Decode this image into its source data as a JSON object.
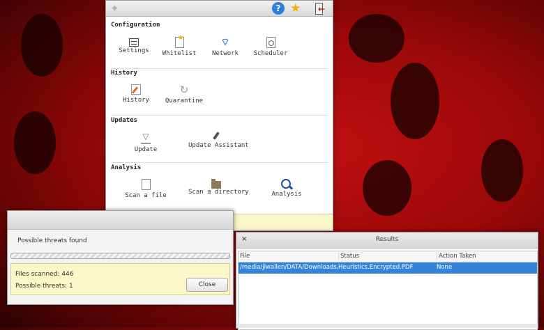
{
  "main": {
    "sections": [
      {
        "title": "Configuration",
        "items": [
          {
            "label": "Settings",
            "icon": "settings-icon"
          },
          {
            "label": "Whitelist",
            "icon": "whitelist-icon"
          },
          {
            "label": "Network",
            "icon": "network-icon"
          },
          {
            "label": "Scheduler",
            "icon": "scheduler-icon"
          }
        ]
      },
      {
        "title": "History",
        "items": [
          {
            "label": "History",
            "icon": "history-icon"
          },
          {
            "label": "Quarantine",
            "icon": "quarantine-icon"
          }
        ]
      },
      {
        "title": "Updates",
        "items": [
          {
            "label": "Update",
            "icon": "update-icon"
          },
          {
            "label": "Update Assistant",
            "icon": "update-assistant-icon"
          }
        ]
      },
      {
        "title": "Analysis",
        "items": [
          {
            "label": "Scan a file",
            "icon": "scan-file-icon"
          },
          {
            "label": "Scan a directory",
            "icon": "scan-directory-icon"
          },
          {
            "label": "Analysis",
            "icon": "analysis-icon"
          }
        ]
      }
    ],
    "toolbar": {
      "help_glyph": "?",
      "icons": [
        "app-logo-icon",
        "help-icon",
        "star-icon",
        "exit-icon"
      ]
    }
  },
  "progress": {
    "message": "Possible threats found",
    "files_scanned": "Files scanned: 446",
    "possible_threats": "Possible threats: 1",
    "close_label": "Close"
  },
  "results": {
    "title": "Results",
    "columns": [
      "File",
      "Status",
      "Action Taken"
    ],
    "rows": [
      {
        "file": "/media/jlwallen/DATA/Downloads/",
        "status": "Heuristics.Encrypted.PDF",
        "action": "None"
      }
    ],
    "close_glyph": "×"
  },
  "colors": {
    "background": "#9a0808",
    "selection": "#3583d8",
    "info_panel": "#fbf7c8"
  }
}
